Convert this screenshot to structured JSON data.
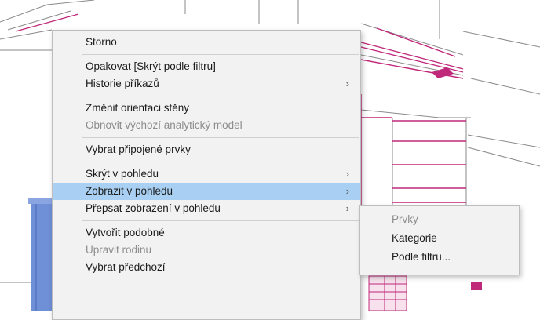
{
  "context_menu": {
    "items": [
      {
        "label": "Storno",
        "enabled": true,
        "submenu": false
      },
      {
        "separator": true
      },
      {
        "label": "Opakovat [Skrýt podle filtru]",
        "enabled": true,
        "submenu": false
      },
      {
        "label": "Historie příkazů",
        "enabled": true,
        "submenu": true
      },
      {
        "separator": true
      },
      {
        "label": "Změnit orientaci stěny",
        "enabled": true,
        "submenu": false
      },
      {
        "label": "Obnovit výchozí analytický model",
        "enabled": false,
        "submenu": false
      },
      {
        "separator": true
      },
      {
        "label": "Vybrat připojené prvky",
        "enabled": true,
        "submenu": false
      },
      {
        "separator": true
      },
      {
        "label": "Skrýt v pohledu",
        "enabled": true,
        "submenu": true
      },
      {
        "label": "Zobrazit v pohledu",
        "enabled": true,
        "submenu": true,
        "highlighted": true
      },
      {
        "label": "Přepsat zobrazení v pohledu",
        "enabled": true,
        "submenu": true
      },
      {
        "separator": true
      },
      {
        "label": "Vytvořit podobné",
        "enabled": true,
        "submenu": false
      },
      {
        "label": "Upravit rodinu",
        "enabled": false,
        "submenu": false
      },
      {
        "label": "Vybrat předchozí",
        "enabled": true,
        "submenu": false
      }
    ],
    "arrow_glyph": "›"
  },
  "submenu": {
    "items": [
      {
        "label": "Prvky",
        "enabled": false
      },
      {
        "label": "Kategorie",
        "enabled": true
      },
      {
        "label": "Podle filtru...",
        "enabled": true
      }
    ]
  },
  "colors": {
    "model_lines": "#c0287a",
    "wall_edges": "#8a8a8a",
    "selected_wall": "#6f8fd6",
    "menu_highlight": "#a9d0f2"
  }
}
